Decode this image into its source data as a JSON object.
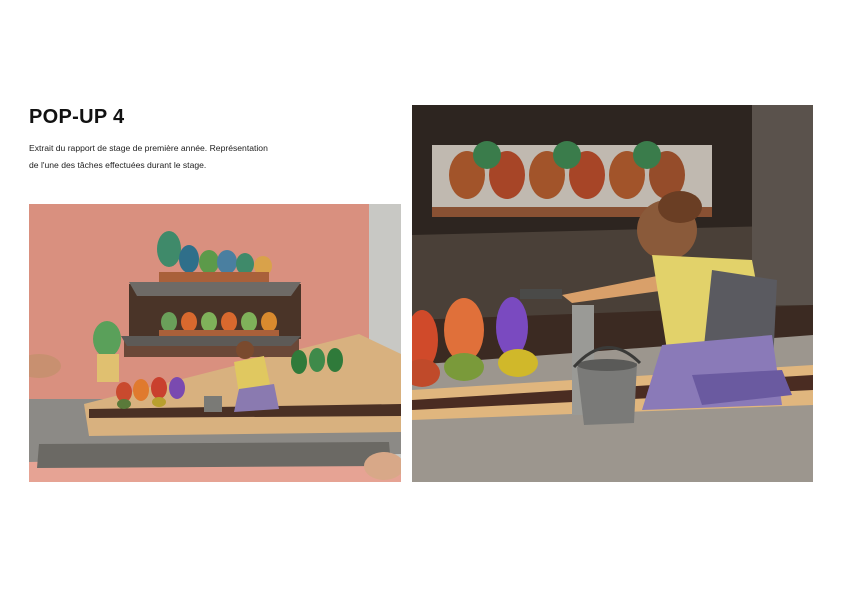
{
  "heading": "POP-UP 4",
  "description": {
    "line1": "Extrait du rapport de stage de première année. Représentation",
    "line2": "de l'une des tâches effectuées durant le stage."
  },
  "photos": [
    {
      "name": "pop-up-book-overview-photo"
    },
    {
      "name": "pop-up-gardener-closeup-photo"
    }
  ],
  "colors": {
    "background": "#ffffff",
    "text": "#111111"
  }
}
